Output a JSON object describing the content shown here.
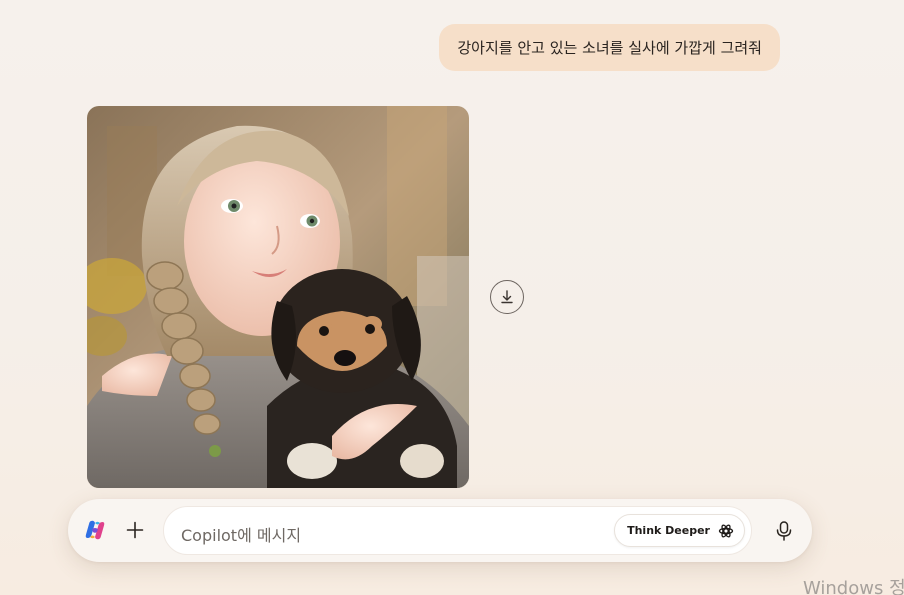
{
  "conversation": {
    "user_message": "강아지를 안고 있는 소녀를 실사에 가깝게 그려줘",
    "generated_image": {
      "subject": "Photorealistic girl with braided hair holding a puppy",
      "download_icon": "download-icon"
    }
  },
  "composer": {
    "logo_icon": "copilot-logo-icon",
    "add_icon": "plus-icon",
    "placeholder": "Copilot에 메시지",
    "think_deeper_label": "Think Deeper",
    "think_deeper_icon": "think-deeper-icon",
    "mic_icon": "microphone-icon"
  },
  "watermark": {
    "text": "Windows 정"
  },
  "colors": {
    "background": "#f6f1ec",
    "user_bubble": "#f6dfc9",
    "composer": "#f9f5f1",
    "input": "#ffffff"
  }
}
